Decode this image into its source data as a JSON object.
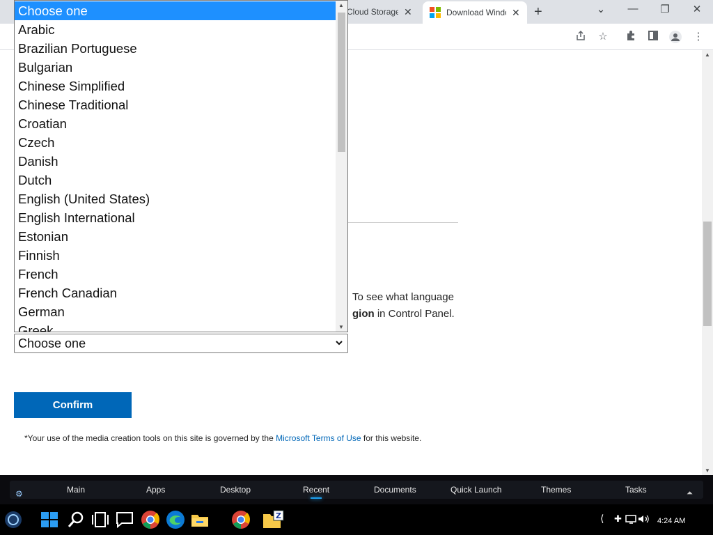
{
  "browser": {
    "tabs": [
      {
        "label": "Cloud Storage Fi"
      },
      {
        "label": "Download Windows"
      }
    ],
    "new_tab_glyph": "+",
    "window_controls": [
      "⌄",
      "—",
      "❐",
      "✕"
    ]
  },
  "page": {
    "paragraph_line1": "To see what language",
    "paragraph_bold": "gion",
    "paragraph_rest": " in Control Panel.",
    "select_value": "Choose one",
    "confirm_label": "Confirm",
    "terms_prefix": "*Your use of the media creation tools on this site is governed by the ",
    "terms_link": "Microsoft Terms of Use",
    "terms_suffix": " for this website."
  },
  "dropdown": {
    "options": [
      "Choose one",
      "Arabic",
      "Brazilian Portuguese",
      "Bulgarian",
      "Chinese Simplified",
      "Chinese Traditional",
      "Croatian",
      "Czech",
      "Danish",
      "Dutch",
      "English (United States)",
      "English International",
      "Estonian",
      "Finnish",
      "French",
      "French Canadian",
      "German",
      "Greek"
    ],
    "selected": "Choose one"
  },
  "dock": {
    "items": [
      "Main",
      "Apps",
      "Desktop",
      "Recent",
      "Documents",
      "Quick Launch",
      "Themes",
      "Tasks"
    ],
    "active": "Recent"
  },
  "taskbar": {
    "clock": "4:24 AM"
  },
  "colors": {
    "accent": "#0067b8",
    "selected_option": "#1e90ff",
    "dock_glow": "#1da1f2"
  }
}
